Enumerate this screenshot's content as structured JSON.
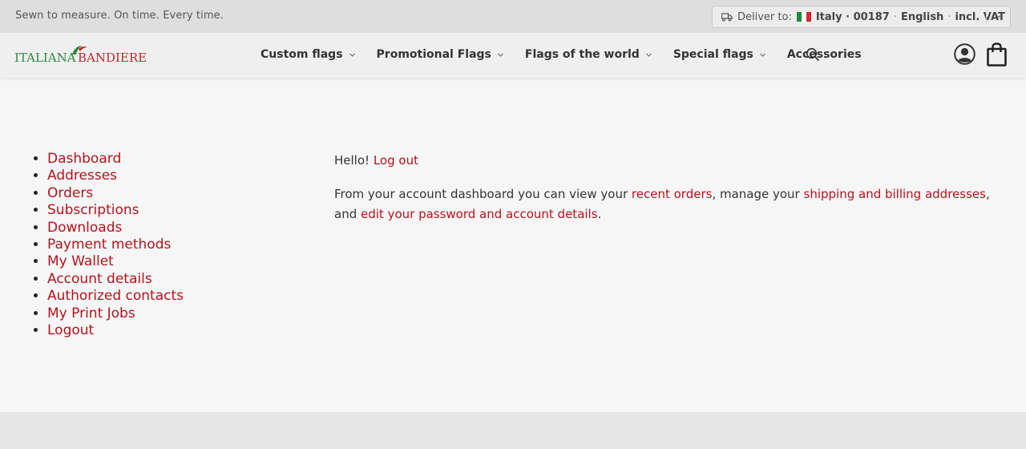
{
  "topbar": {
    "tagline": "Sewn to measure. On time. Every time.",
    "deliver_label": "Deliver to:",
    "country": "Italy · 00187",
    "language": "English",
    "vat": "incl. VAT",
    "icons": [
      "truck-icon",
      "italy-flag-icon",
      "chevron-down-icon"
    ]
  },
  "logo": {
    "part1": "ITALIANA",
    "part2": "BANDIERE"
  },
  "nav": {
    "items": [
      {
        "label": "Custom flags",
        "dropdown": true
      },
      {
        "label": "Promotional Flags",
        "dropdown": true
      },
      {
        "label": "Flags of the world",
        "dropdown": true
      },
      {
        "label": "Special flags",
        "dropdown": true
      },
      {
        "label": "Accessories",
        "dropdown": false
      }
    ],
    "icons": [
      "search-icon",
      "user-icon",
      "shopping-bag-icon"
    ]
  },
  "account_menu": [
    "Dashboard",
    "Addresses",
    "Orders",
    "Subscriptions",
    "Downloads",
    "Payment methods",
    "My Wallet",
    "Account details",
    "Authorized contacts",
    "My Print Jobs",
    "Logout"
  ],
  "content": {
    "hello": "Hello!",
    "logout_link": "Log out",
    "intro_1": "From your account dashboard you can view your ",
    "link_orders": "recent orders",
    "intro_2": ", manage your ",
    "link_addresses": "shipping and billing addresses",
    "intro_3": ", and ",
    "link_account": "edit your password and account details",
    "intro_4": "."
  },
  "colors": {
    "accent": "#b5121b",
    "logo_green": "#2e8b3e",
    "logo_red": "#c0272d"
  }
}
